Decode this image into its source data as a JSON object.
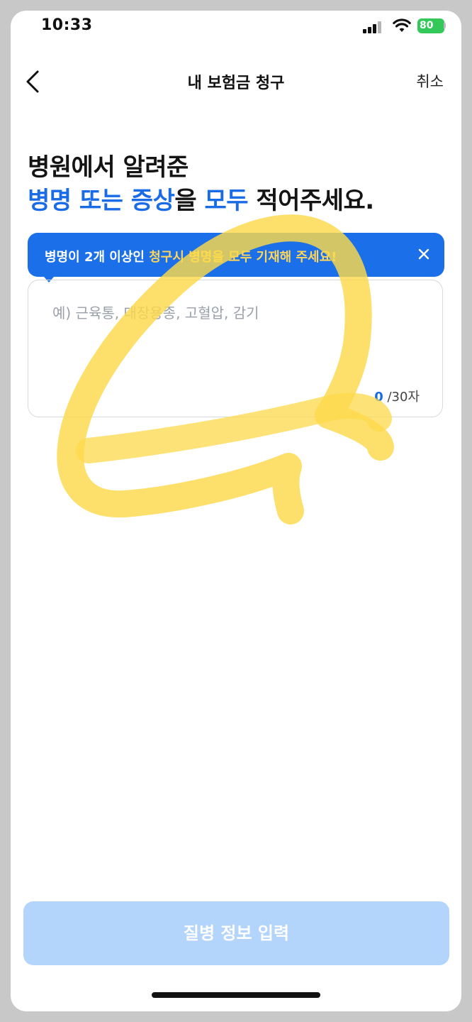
{
  "status_bar": {
    "time": "10:33",
    "battery": "80"
  },
  "nav": {
    "title": "내 보험금 청구",
    "cancel_label": "취소"
  },
  "heading": {
    "line1": "병원에서 알려준",
    "line2_part1": "병명 또는 증상",
    "line2_part2": "을 ",
    "line2_part3": "모두",
    "line2_part4": " 적어주세요."
  },
  "tooltip": {
    "text_normal": "병명이 2개 이상인 ",
    "text_highlight": "청구시 병명을 모두 기재해 주세요!"
  },
  "input": {
    "placeholder": "예) 근육통, 대장용종, 고혈압, 감기",
    "count": "0",
    "max_suffix": "/30자"
  },
  "submit": {
    "label": "질병 정보 입력"
  },
  "colors": {
    "accent": "#1a6be6",
    "tooltip_bg": "#1b6fe8",
    "tooltip_highlight": "#ffd65a",
    "button_disabled": "#b3d4fb",
    "scribble": "#fcd94a",
    "battery": "#34c759"
  }
}
